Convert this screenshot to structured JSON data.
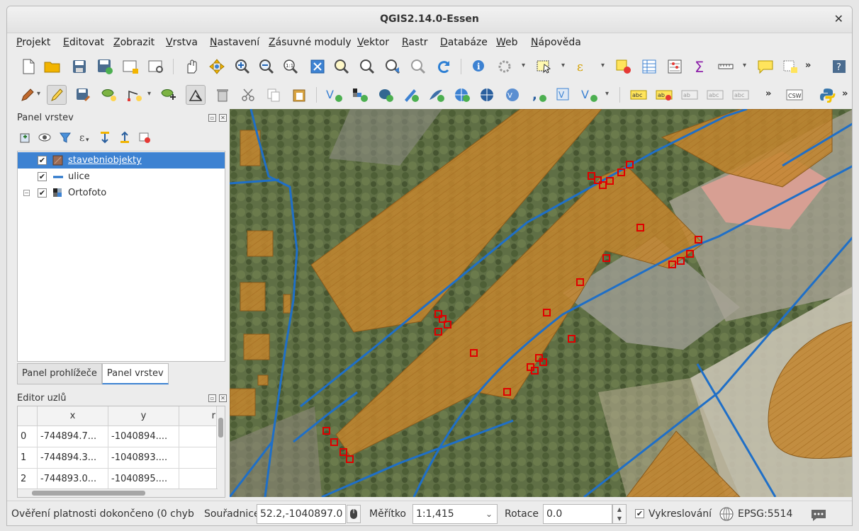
{
  "window": {
    "title": "QGIS2.14.0-Essen",
    "close": "✕"
  },
  "menubar": [
    "Projekt",
    "Editovat",
    "Zobrazit",
    "Vrstva",
    "Nastavení",
    "Zásuvné moduly",
    "Vektor",
    "Rastr",
    "Databáze",
    "Web",
    "Nápověda"
  ],
  "toolbar_more": "»",
  "layers_panel": {
    "title": "Panel vrstev",
    "layers": [
      {
        "name": "stavebniobjekty",
        "checked": "✔",
        "selected": true
      },
      {
        "name": "ulice",
        "checked": "✔"
      },
      {
        "name": "Ortofoto",
        "checked": "✔",
        "expander": "−"
      }
    ],
    "tabs": [
      "Panel prohlížeče",
      "Panel vrstev"
    ],
    "active_tab": "Panel vrstev"
  },
  "node_editor": {
    "title": "Editor uzlů",
    "columns": [
      "",
      "x",
      "y",
      "r"
    ],
    "rows": [
      [
        "0",
        "-744894.7...",
        "-1040894...."
      ],
      [
        "1",
        "-744894.3...",
        "-1040893...."
      ],
      [
        "2",
        "-744893.0...",
        "-1040895...."
      ]
    ]
  },
  "statusbar": {
    "message": "Ověření platnosti dokončeno (0 chyb",
    "coord_label": "Souřadnice",
    "coord_value": "52.2,-1040897.0",
    "scale_label": "Měřítko",
    "scale_value": "1:1,415",
    "rotation_label": "Rotace",
    "rotation_value": "0.0",
    "render_label": "Vykreslování",
    "render_checked": "✔",
    "crs": "EPSG:5514"
  },
  "colors": {
    "selection_blue": "#3d82d2",
    "building_fill": "#c88a2e",
    "street_line": "#1f6fc7",
    "vertex_marker": "#e00000"
  },
  "icons": [
    "new-project-icon",
    "open-icon",
    "save-icon",
    "save-as-icon",
    "print-composer-icon",
    "composer-manager-icon",
    "pan-icon",
    "pan-to-selection-icon",
    "zoom-in-icon",
    "zoom-out-icon",
    "zoom-native-icon",
    "zoom-full-icon",
    "zoom-to-selection-icon",
    "zoom-to-layer-icon",
    "zoom-last-icon",
    "zoom-next-icon",
    "refresh-icon",
    "identify-icon",
    "run-action-icon",
    "select-icon",
    "deselect-icon",
    "attribute-table-icon",
    "statistics-icon",
    "sum-icon",
    "measure-icon",
    "annotation-icon",
    "label-icon",
    "help-icon",
    "python-icon",
    "csw-icon"
  ]
}
